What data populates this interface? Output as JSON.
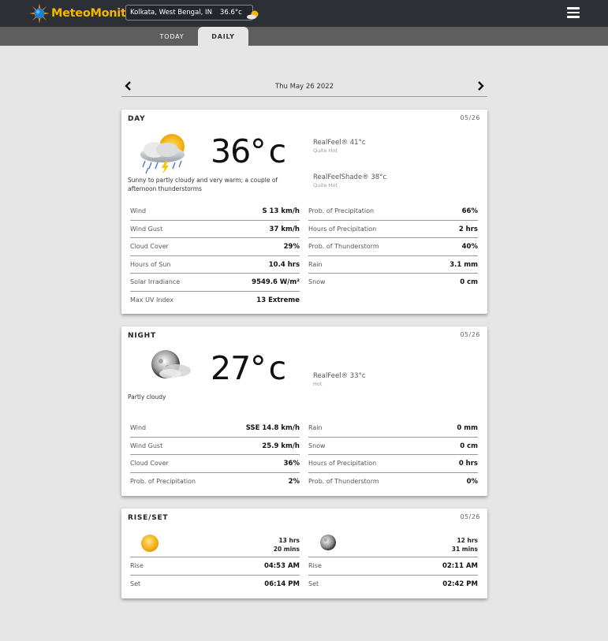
{
  "header": {
    "brand": "MeteoMonitor",
    "location": "Kolkata, West Bengal, IN",
    "location_temp": "36.6°c",
    "icons": {
      "logo": "sun-logo-icon",
      "weather": "sun-cloud-icon",
      "menu": "hamburger-menu-icon"
    },
    "colors": {
      "brand": "#f5b800",
      "bar": "#2c2f36"
    }
  },
  "tabs": [
    {
      "label": "TODAY"
    },
    {
      "label": "DAILY"
    }
  ],
  "date_nav": {
    "label": "Thu May 26 2022"
  },
  "day": {
    "title": "DAY",
    "date": "05/26",
    "temp": "36",
    "unit": "c",
    "icon": "sun-cloud-rain-thunder-icon",
    "description": "Sunny to partly cloudy and very warm; a couple of afternoon thunderstorms",
    "realfeel": "RealFeel® 41°c",
    "realfeel_sub": "Quite Hot",
    "realfeel_shade": "RealFeelShade® 38°c",
    "realfeel_shade_sub": "Quite Hot",
    "left": [
      {
        "label": "Wind",
        "value": "S  13 km/h"
      },
      {
        "label": "Wind Gust",
        "value": "37 km/h"
      },
      {
        "label": "Cloud Cover",
        "value": "29%"
      },
      {
        "label": "Hours of Sun",
        "value": "10.4 hrs"
      },
      {
        "label": "Solar Irradiance",
        "value": "9549.6 W/m²"
      },
      {
        "label": "Max UV Index",
        "value": "13 Extreme"
      }
    ],
    "right": [
      {
        "label": "Prob. of Precipitation",
        "value": "66%"
      },
      {
        "label": "Hours of Precipitation",
        "value": "2 hrs"
      },
      {
        "label": "Prob. of Thunderstorm",
        "value": "40%"
      },
      {
        "label": "Rain",
        "value": "3.1 mm"
      },
      {
        "label": "Snow",
        "value": "0 cm"
      }
    ]
  },
  "night": {
    "title": "NIGHT",
    "date": "05/26",
    "temp": "27",
    "unit": "c",
    "icon": "moon-cloud-icon",
    "description": "Partly cloudy",
    "realfeel": "RealFeel® 33°c",
    "realfeel_sub": "Hot",
    "left": [
      {
        "label": "Wind",
        "value": "SSE  14.8 km/h"
      },
      {
        "label": "Wind Gust",
        "value": "25.9 km/h"
      },
      {
        "label": "Cloud Cover",
        "value": "36%"
      },
      {
        "label": "Prob. of Precipitation",
        "value": "2%"
      }
    ],
    "right": [
      {
        "label": "Rain",
        "value": "0 mm"
      },
      {
        "label": "Snow",
        "value": "0 cm"
      },
      {
        "label": "Hours of Precipitation",
        "value": "0 hrs"
      },
      {
        "label": "Prob. of Thunderstorm",
        "value": "0%"
      }
    ]
  },
  "riseset": {
    "title": "RISE/SET",
    "date": "05/26",
    "sun": {
      "icon": "sun-icon",
      "dur_hrs": "13 hrs",
      "dur_mins": "20 mins",
      "rows": [
        {
          "label": "Rise",
          "value": "04:53 AM"
        },
        {
          "label": "Set",
          "value": "06:14 PM"
        }
      ]
    },
    "moon": {
      "icon": "moon-icon",
      "dur_hrs": "12 hrs",
      "dur_mins": "31 mins",
      "rows": [
        {
          "label": "Rise",
          "value": "02:11 AM"
        },
        {
          "label": "Set",
          "value": "02:42 PM"
        }
      ]
    }
  }
}
